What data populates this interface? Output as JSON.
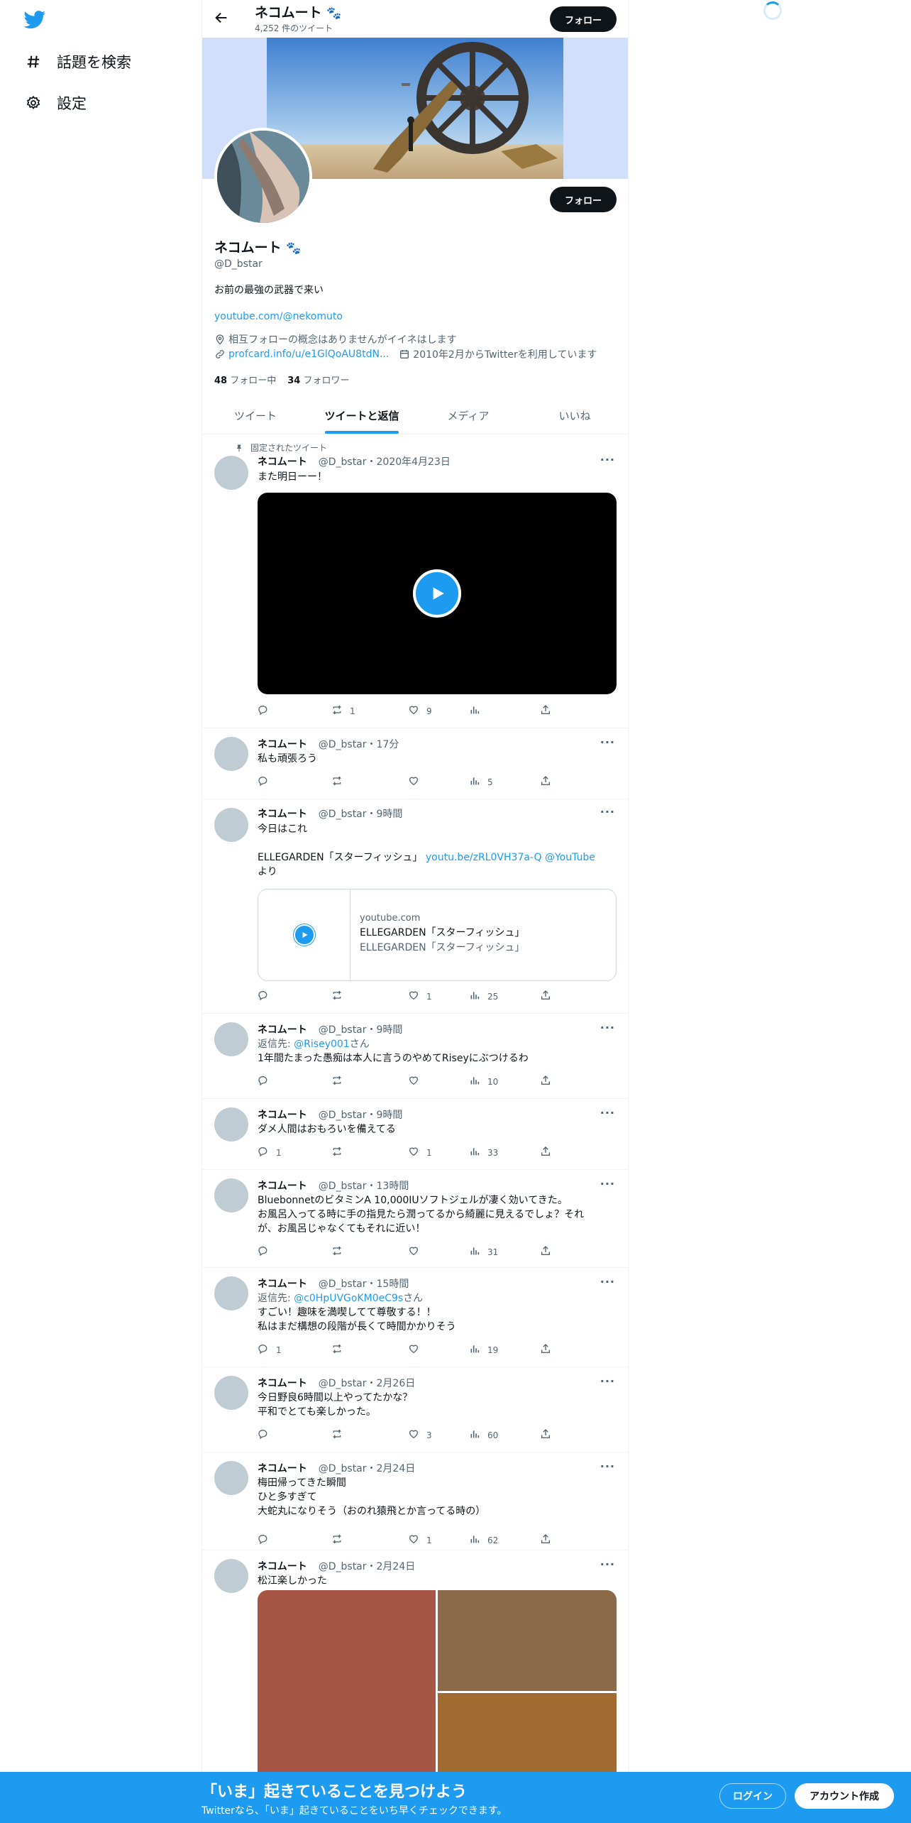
{
  "nav": {
    "explore_label": "話題を検索",
    "settings_label": "設定"
  },
  "header": {
    "name": "ネコムート",
    "tweet_count": "4,252 件のツイート",
    "follow_label": "フォロー"
  },
  "profile": {
    "name": "ネコムート",
    "handle": "@D_bstar",
    "bio": "お前の最強の武器で来い",
    "website": "youtube.com/@nekomuto",
    "location": "相互フォローの概念はありませんがイイネはします",
    "profile_link": "profcard.info/u/e1GlQoAU8tdN...",
    "joined": "2010年2月からTwitterを利用しています",
    "following_count": "48",
    "following_label": "フォロー中",
    "followers_count": "34",
    "followers_label": "フォロワー",
    "follow_label": "フォロー"
  },
  "tabs": [
    {
      "label": "ツイート"
    },
    {
      "label": "ツイートと返信"
    },
    {
      "label": "メディア"
    },
    {
      "label": "いいね"
    }
  ],
  "tweets": [
    {
      "pinned_label": "固定されたツイート",
      "name": "ネコムート",
      "meta": "@D_bstar・2020年4月23日",
      "text": "また明日ーー！",
      "reply": "",
      "retweet": "1",
      "like": "9",
      "views": ""
    },
    {
      "name": "ネコムート",
      "meta": "@D_bstar・17分",
      "text": "私も頑張ろう",
      "reply": "",
      "retweet": "",
      "like": "",
      "views": "5"
    },
    {
      "name": "ネコムート",
      "meta": "@D_bstar・9時間",
      "text_line1": "今日はこれ",
      "text_line2": "ELLEGARDEN「スターフィッシュ」",
      "link1": "youtu.be/zRL0VH37a-Q",
      "link2": "@YouTube",
      "text_line3": "より",
      "card": {
        "domain": "youtube.com",
        "title": "ELLEGARDEN「スターフィッシュ」",
        "description": "ELLEGARDEN「スターフィッシュ」"
      },
      "reply": "",
      "retweet": "",
      "like": "1",
      "views": "25"
    },
    {
      "name": "ネコムート",
      "meta": "@D_bstar・9時間",
      "reply_to_prefix": "返信先: ",
      "reply_to": "@Risey001",
      "reply_to_suffix": "さん",
      "text": "1年間たまった愚痴は本人に言うのやめてRiseyにぶつけるわ",
      "reply": "",
      "retweet": "",
      "like": "",
      "views": "10"
    },
    {
      "name": "ネコムート",
      "meta": "@D_bstar・9時間",
      "text": "ダメ人間はおもろいを備えてる",
      "reply": "1",
      "retweet": "",
      "like": "1",
      "views": "33"
    },
    {
      "name": "ネコムート",
      "meta": "@D_bstar・13時間",
      "text_line1": "BluebonnetのビタミンA 10,000IUソフトジェルが凄く効いてきた。",
      "text_line2": "お風呂入ってる時に手の指見たら潤ってるから綺麗に見えるでしょ？それ",
      "text_line3": "が、お風呂じゃなくてもそれに近い！",
      "reply": "",
      "retweet": "",
      "like": "",
      "views": "31"
    },
    {
      "name": "ネコムート",
      "meta": "@D_bstar・15時間",
      "reply_to_prefix": "返信先: ",
      "reply_to": "@c0HpUVGoKM0eC9s",
      "reply_to_suffix": "さん",
      "text_line1": "すごい！趣味を満喫してて尊敬する！！",
      "text_line2": "私はまだ構想の段階が長くて時間かかりそう",
      "reply": "1",
      "retweet": "",
      "like": "",
      "views": "19"
    },
    {
      "name": "ネコムート",
      "meta": "@D_bstar・2月26日",
      "text_line1": "今日野良6時間以上やってたかな？",
      "text_line2": "平和でとても楽しかった。",
      "reply": "",
      "retweet": "",
      "like": "3",
      "views": "60"
    },
    {
      "name": "ネコムート",
      "meta": "@D_bstar・2月24日",
      "text_line1": "梅田帰ってきた瞬間",
      "text_line2": "ひと多すぎて",
      "text_line3": "大蛇丸になりそう（おのれ猿飛とか言ってる時の）",
      "reply": "",
      "retweet": "",
      "like": "1",
      "views": "62"
    },
    {
      "name": "ネコムート",
      "meta": "@D_bstar・2月24日",
      "text": "松江楽しかった"
    }
  ],
  "bottom_bar": {
    "title": "「いま」起きていることを見つけよう",
    "subtitle": "Twitterなら、「いま」起きていることをいち早くチェックできます。",
    "login_label": "ログイン",
    "signup_label": "アカウント作成"
  },
  "colors": {
    "accent": "#1d9bf0",
    "banner_bg": "#d1dffc",
    "text_secondary": "#536471"
  }
}
